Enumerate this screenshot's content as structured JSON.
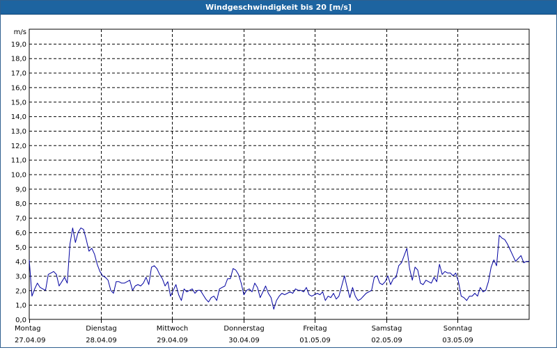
{
  "window": {
    "title": "Windgeschwindigkeit bis 20 [m/s]"
  },
  "colors": {
    "titlebar": "#1d64a0",
    "line": "#0000a0",
    "grid": "#000000"
  },
  "chart_data": {
    "type": "line",
    "title": "Windgeschwindigkeit bis 20 [m/s]",
    "ylabel": "m/s",
    "ylim": [
      0,
      20
    ],
    "yticks": [
      "19,0",
      "18,0",
      "17,0",
      "16,0",
      "15,0",
      "14,0",
      "13,0",
      "12,0",
      "11,0",
      "10,0",
      "9,0",
      "8,0",
      "7,0",
      "6,0",
      "5,0",
      "4,0",
      "3,0",
      "2,0",
      "1,0",
      "0,0"
    ],
    "grid": true,
    "x_range_days": [
      0,
      7
    ],
    "days": [
      {
        "weekday": "Montag",
        "date": "27.04.09"
      },
      {
        "weekday": "Dienstag",
        "date": "28.04.09"
      },
      {
        "weekday": "Mittwoch",
        "date": "29.04.09"
      },
      {
        "weekday": "Donnerstag",
        "date": "30.04.09"
      },
      {
        "weekday": "Freitag",
        "date": "01.05.09"
      },
      {
        "weekday": "Samstag",
        "date": "02.05.09"
      },
      {
        "weekday": "Sonntag",
        "date": "03.05.09"
      }
    ],
    "series": [
      {
        "values": [
          4.1,
          1.6,
          2.1,
          2.5,
          2.2,
          2.1,
          2.0,
          3.1,
          3.2,
          3.3,
          3.1,
          2.3,
          2.6,
          2.9,
          2.5,
          5.2,
          6.3,
          5.3,
          6.0,
          6.3,
          6.2,
          5.5,
          4.7,
          4.9,
          4.5,
          3.8,
          3.3,
          3.0,
          2.9,
          2.7,
          2.0,
          1.8,
          2.6,
          2.6,
          2.5,
          2.5,
          2.6,
          2.7,
          2.0,
          2.3,
          2.4,
          2.3,
          2.5,
          2.9,
          2.4,
          3.6,
          3.7,
          3.5,
          3.1,
          2.8,
          2.3,
          2.6,
          1.6,
          2.0,
          2.4,
          1.7,
          1.3,
          2.1,
          1.9,
          2.0,
          2.1,
          1.8,
          2.0,
          2.0,
          1.7,
          1.4,
          1.2,
          1.5,
          1.6,
          1.3,
          2.1,
          2.2,
          2.3,
          2.8,
          2.8,
          3.5,
          3.4,
          3.1,
          2.5,
          1.7,
          2.0,
          2.1,
          1.9,
          2.5,
          2.2,
          1.5,
          1.9,
          2.3,
          1.8,
          1.5,
          0.7,
          1.3,
          1.6,
          1.8,
          1.7,
          1.8,
          1.9,
          1.8,
          2.1,
          2.0,
          2.0,
          1.9,
          2.2,
          1.7,
          1.6,
          1.7,
          1.8,
          1.7,
          1.9,
          1.3,
          1.6,
          1.5,
          1.8,
          1.4,
          1.6,
          2.3,
          3.0,
          2.2,
          1.5,
          2.2,
          1.6,
          1.3,
          1.4,
          1.6,
          1.8,
          1.9,
          2.0,
          2.9,
          3.0,
          2.5,
          2.4,
          2.6,
          3.0,
          2.4,
          2.8,
          2.9,
          3.7,
          3.9,
          4.4,
          4.9,
          3.5,
          2.7,
          3.6,
          3.4,
          2.5,
          2.4,
          2.7,
          2.6,
          2.5,
          2.9,
          2.6,
          3.8,
          3.1,
          3.3,
          3.2,
          3.2,
          3.0,
          3.2,
          2.6,
          1.6,
          1.5,
          1.3,
          1.6,
          1.6,
          1.8,
          1.6,
          2.2,
          1.9,
          2.0,
          2.6,
          3.6,
          4.1,
          3.7,
          5.8,
          5.6,
          5.5,
          5.2,
          4.8,
          4.4,
          4.0,
          4.2,
          4.4,
          3.9,
          4.0,
          4.0
        ]
      }
    ]
  }
}
